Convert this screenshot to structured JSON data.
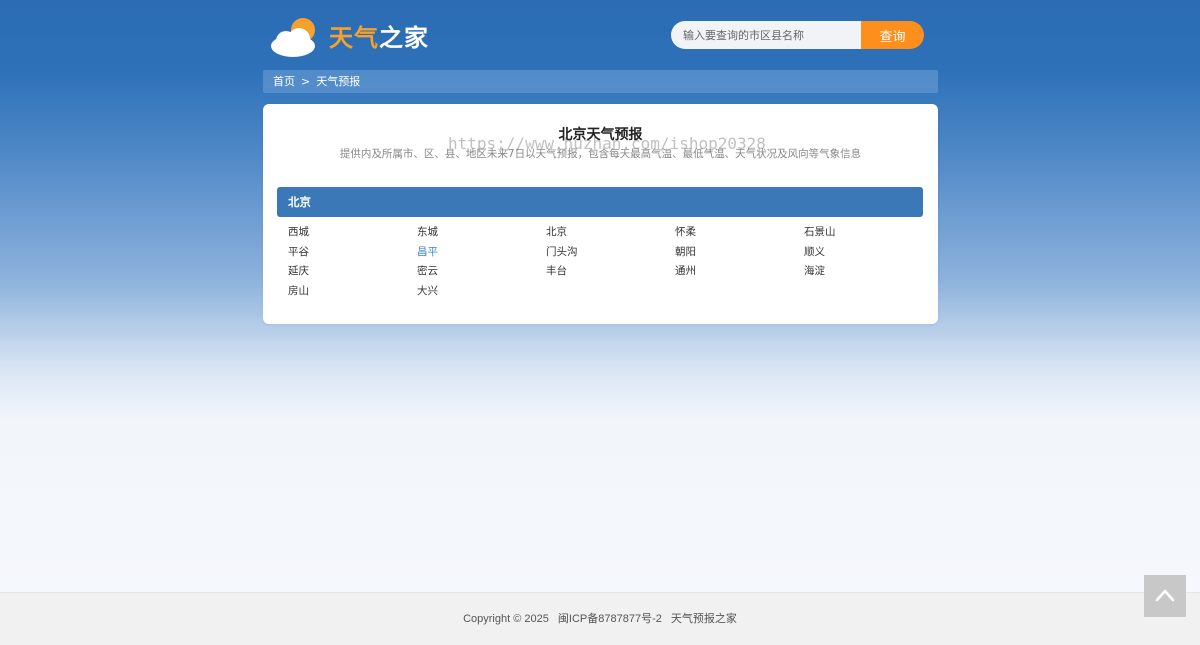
{
  "header": {
    "logo_text_part1": "天气",
    "logo_text_part2": "之家",
    "search": {
      "placeholder": "输入要查询的市区县名称",
      "value": "",
      "button_label": "查询"
    }
  },
  "breadcrumb": {
    "home": "首页",
    "separator": ">",
    "current": "天气预报"
  },
  "main": {
    "title": "北京天气预报",
    "description": "提供内及所属市、区、县、地区未来7日以天气预报，包含每天最高气温、最低气温、天气状况及风向等气象信息",
    "watermark": "https://www.huzhan.com/ishop20328",
    "province": "北京",
    "cities": [
      "西城",
      "东城",
      "北京",
      "怀柔",
      "石景山",
      "平谷",
      "昌平",
      "门头沟",
      "朝阳",
      "顺义",
      "延庆",
      "密云",
      "丰台",
      "通州",
      "海淀",
      "房山",
      "大兴"
    ],
    "active_city": "昌平"
  },
  "footer": {
    "copyright": "Copyright © 2025",
    "icp": "闽ICP备8787877号-2",
    "site_name": "天气预报之家"
  },
  "colors": {
    "accent_orange": "#ff8f1c",
    "province_bar": "#3a78b8",
    "active_link": "#3a86d4"
  },
  "icons": {
    "logo": "cloud-sun-icon",
    "back_to_top": "chevron-up-icon"
  }
}
